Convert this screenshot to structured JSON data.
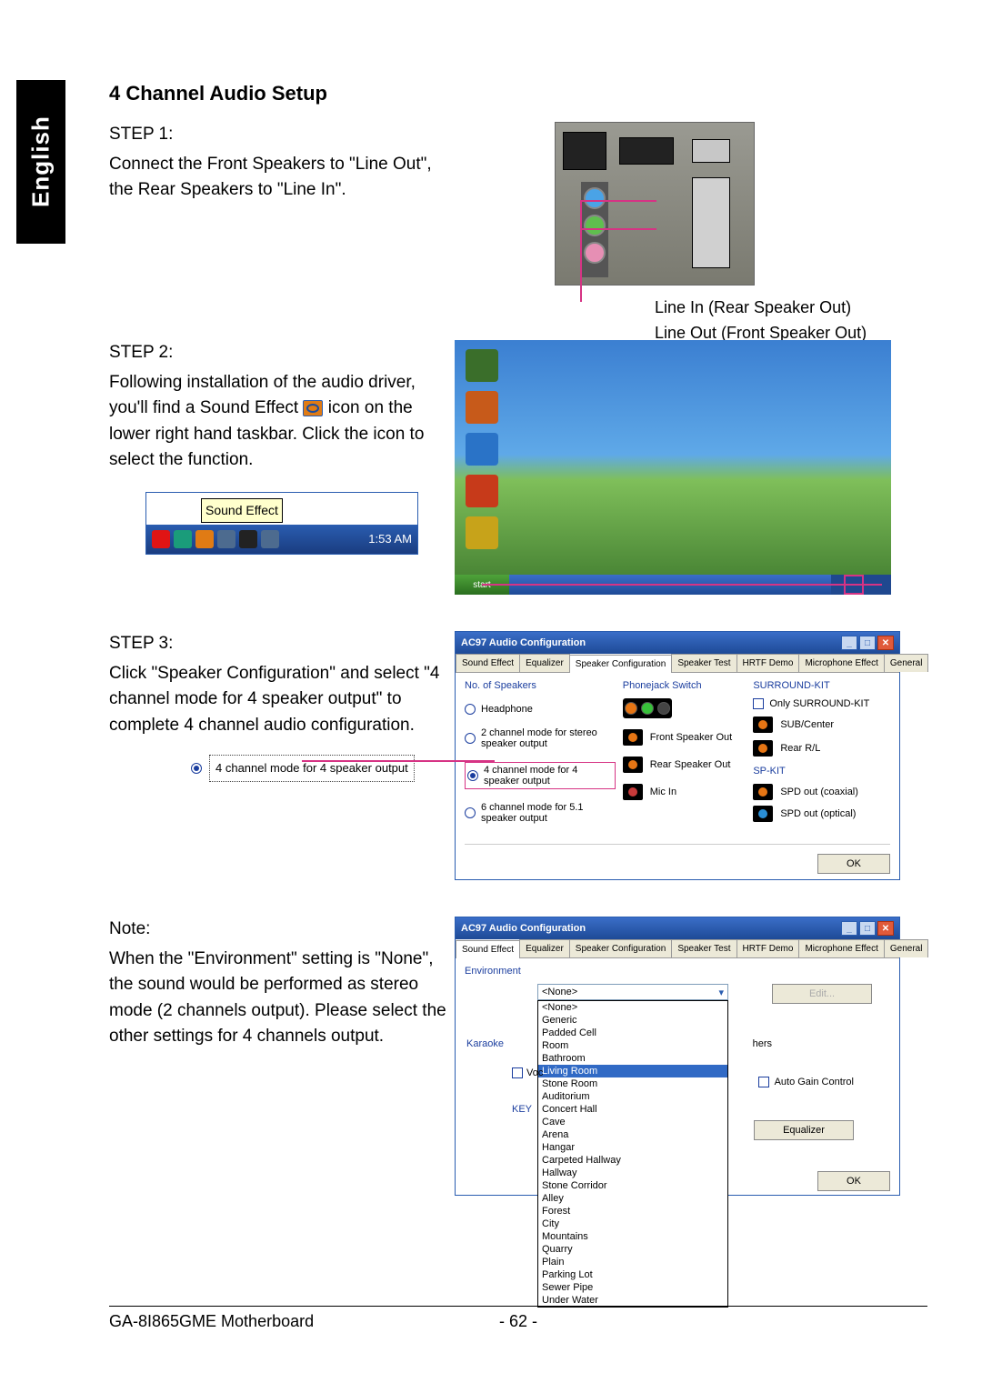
{
  "side_tab": "English",
  "title": "4 Channel Audio Setup",
  "step1": {
    "label": "STEP 1:",
    "text": "Connect the Front Speakers to \"Line Out\", the Rear Speakers to \"Line In\".",
    "line_in_label": "Line In (Rear Speaker Out)",
    "line_out_label": "Line Out (Front Speaker Out)"
  },
  "step2": {
    "label": "STEP 2:",
    "text_a": "Following installation of the audio driver, you'll find a Sound Effect ",
    "text_b": " icon on the lower right hand taskbar. Click the icon to select the function.",
    "tooltip": "Sound Effect",
    "time": "1:53 AM",
    "start": "start"
  },
  "step3": {
    "label": "STEP 3:",
    "text": "Click \"Speaker Configuration\" and select \"4 channel mode for 4 speaker output\" to complete 4 channel audio configuration.",
    "callout": "4 channel mode for 4 speaker output"
  },
  "note": {
    "label": "Note:",
    "text": "When the \"Environment\" setting is \"None\", the sound would be performed as stereo mode (2 channels output). Please select the other settings for 4 channels output."
  },
  "dialog": {
    "title": "AC97 Audio Configuration",
    "tabs": [
      "Sound Effect",
      "Equalizer",
      "Speaker Configuration",
      "Speaker Test",
      "HRTF Demo",
      "Microphone Effect",
      "General"
    ],
    "ok": "OK",
    "speakers_hdr": "No. of Speakers",
    "phonejack_hdr": "Phonejack Switch",
    "surround_hdr": "SURROUND-KIT",
    "only_surround": "Only SURROUND-KIT",
    "sub_center": "SUB/Center",
    "rear_rl": "Rear R/L",
    "sp_kit": "SP-KIT",
    "spd_coax": "SPD out (coaxial)",
    "spd_opt": "SPD out (optical)",
    "radio_headphone": "Headphone",
    "radio_2ch": "2 channel mode for stereo speaker output",
    "radio_4ch": "4 channel mode for 4 speaker output",
    "radio_6ch": "6 channel mode for 5.1 speaker output",
    "front_out": "Front Speaker Out",
    "rear_out": "Rear Speaker Out",
    "mic_in": "Mic In"
  },
  "env_dialog": {
    "environment": "Environment",
    "karaoke": "Karaoke",
    "voc": "Voc",
    "key": "KEY",
    "others": "hers",
    "auto_gain": "Auto Gain Control",
    "equalizer": "Equalizer",
    "edit": "Edit...",
    "selected": "<None>",
    "list": [
      "<None>",
      "Generic",
      "Padded Cell",
      "Room",
      "Bathroom",
      "Living Room",
      "Stone Room",
      "Auditorium",
      "Concert Hall",
      "Cave",
      "Arena",
      "Hangar",
      "Carpeted Hallway",
      "Hallway",
      "Stone Corridor",
      "Alley",
      "Forest",
      "City",
      "Mountains",
      "Quarry",
      "Plain",
      "Parking Lot",
      "Sewer Pipe",
      "Under Water"
    ]
  },
  "footer": {
    "model": "GA-8I865GME Motherboard",
    "page": "- 62 -"
  }
}
